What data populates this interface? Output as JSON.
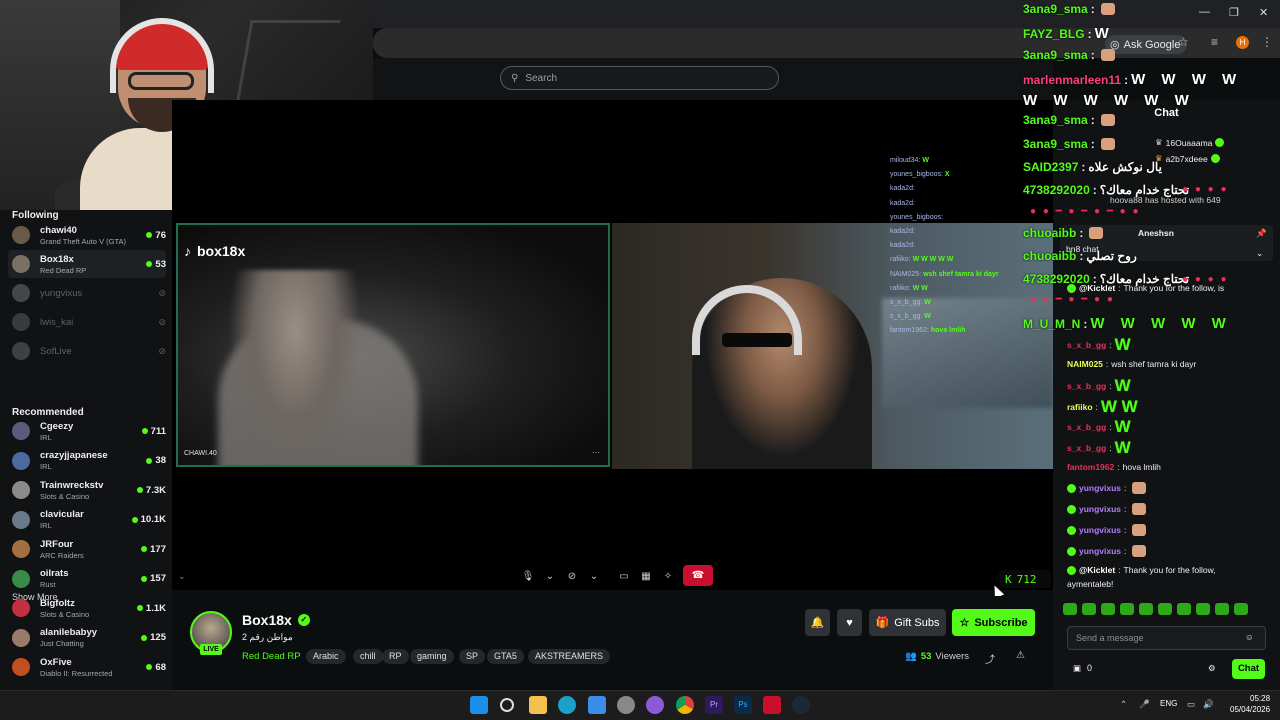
{
  "browser": {
    "ask_google": "Ask Google"
  },
  "search": {
    "placeholder": "Search"
  },
  "sidebar": {
    "following_title": "Following",
    "following": [
      {
        "name": "chawi40",
        "game": "Grand Theft Auto V (GTA)",
        "viewers": "76",
        "online": true,
        "color": "#6b5a4a"
      },
      {
        "name": "Box18x",
        "game": "Red Dead RP",
        "viewers": "53",
        "online": true,
        "active": true,
        "color": "#7a7064"
      },
      {
        "name": "yungvixus",
        "online": false,
        "color": "#aaa"
      },
      {
        "name": "lwis_kai",
        "online": false,
        "color": "#888"
      },
      {
        "name": "SofLive",
        "online": false,
        "color": "#999"
      }
    ],
    "show_more": "Show More",
    "recommended_title": "Recommended",
    "recommended": [
      {
        "name": "Cgeezy",
        "game": "IRL",
        "viewers": "711",
        "color": "#5a5a7a"
      },
      {
        "name": "crazyjjapanese",
        "game": "IRL",
        "viewers": "38",
        "color": "#4a6aa0"
      },
      {
        "name": "Trainwreckstv",
        "game": "Slots & Casino",
        "viewers": "7.3K",
        "color": "#8a8a8a"
      },
      {
        "name": "clavicular",
        "game": "IRL",
        "viewers": "10.1K",
        "color": "#6a7a8a"
      },
      {
        "name": "JRFour",
        "game": "ARC Raiders",
        "viewers": "177",
        "color": "#a07040"
      },
      {
        "name": "oilrats",
        "game": "Rust",
        "viewers": "157",
        "color": "#3a8a4a"
      },
      {
        "name": "Bigfoltz",
        "game": "Slots & Casino",
        "viewers": "1.1K",
        "color": "#c03040"
      },
      {
        "name": "alanilebabyy",
        "game": "Just Chatting",
        "viewers": "125",
        "color": "#9a7a6a"
      },
      {
        "name": "OxFive",
        "game": "Diablo II: Resurrected",
        "viewers": "68",
        "color": "#c05020"
      }
    ]
  },
  "video": {
    "brand": "box18x",
    "tile_name": "CHAWI.40",
    "overlay_count": "712"
  },
  "channel": {
    "name": "Box18x",
    "live_label": "LIVE",
    "title": "2 مواطن رقم",
    "category": "Red Dead RP",
    "tags": [
      "Arabic",
      "chill",
      "RP",
      "gaming",
      "SP",
      "GTA5",
      "AKSTREAMERS"
    ],
    "gift_subs": "Gift Subs",
    "subscribe": "Subscribe",
    "viewers_count": "53",
    "viewers_label": "Viewers"
  },
  "video_chat": [
    {
      "user": "miloud34",
      "text": "W"
    },
    {
      "user": "younes_bigboos",
      "text": "X"
    },
    {
      "user": "kada2d",
      "text": ""
    },
    {
      "user": "kada2d",
      "text": ""
    },
    {
      "user": "younes_bigboos",
      "text": ""
    },
    {
      "user": "kada2d",
      "text": ""
    },
    {
      "user": "kada2d",
      "text": ""
    },
    {
      "user": "rafiiko",
      "text": "W W W W W"
    },
    {
      "user": "NAIM025",
      "text": "wsh shef tamra ki dayr"
    },
    {
      "user": "rafiiko",
      "text": "W W"
    },
    {
      "user": "s_x_b_gg",
      "text": "W"
    },
    {
      "user": "s_x_b_gg",
      "text": "W"
    },
    {
      "user": "fantom1962",
      "text": "hova lmlih"
    }
  ],
  "overlay_chat": [
    {
      "user": "3ana9_sma",
      "color": "#53fc18",
      "msg": ""
    },
    {
      "user": "FAYZ_BLG",
      "color": "#53fc18",
      "msg": "W"
    },
    {
      "user": "3ana9_sma",
      "color": "#53fc18",
      "msg": ""
    },
    {
      "user": "marlenmarleen11",
      "color": "#ff3d7f",
      "msg": "W W W W"
    },
    {
      "user": "",
      "color": "#fff",
      "msg": "W W W W W W"
    },
    {
      "user": "3ana9_sma",
      "color": "#53fc18",
      "msg": ""
    },
    {
      "user": "3ana9_sma",
      "color": "#53fc18",
      "msg": ""
    },
    {
      "user": "SAID2397",
      "color": "#53fc18",
      "msg": "يال نوكش علاه"
    },
    {
      "user": "4738292020",
      "color": "#53fc18",
      "msg": "تحتاج خدام معاك؟"
    },
    {
      "user": "chuoaibb",
      "color": "#53fc18",
      "msg": ""
    },
    {
      "user": "chuoaibb",
      "color": "#53fc18",
      "msg": "روح تصلي"
    },
    {
      "user": "4738292020",
      "color": "#53fc18",
      "msg": "تحتاج خدام معاك؟"
    },
    {
      "user": "M_U_M_N",
      "color": "#53fc18",
      "msg": "W W W W W"
    }
  ],
  "chat": {
    "title": "Chat",
    "top_users": [
      "16Ouaaama",
      "a2b7xdeee"
    ],
    "pinned_user": "Aneshsn",
    "pinned_text": "bn8 chat",
    "messages": [
      {
        "user": "@Kicklet",
        "ucolor": "#fff",
        "text": "Thank you for the follow, is"
      },
      {
        "user": "s_x_b_gg",
        "ucolor": "#e8305a",
        "text": "W"
      },
      {
        "user": "NAIM025",
        "ucolor": "#e8ff5a",
        "text": "wsh shef tamra ki dayr"
      },
      {
        "user": "s_x_b_gg",
        "ucolor": "#e8305a",
        "text": "W"
      },
      {
        "user": "rafiiko",
        "ucolor": "#e8ff5a",
        "text": "W W"
      },
      {
        "user": "s_x_b_gg",
        "ucolor": "#e8305a",
        "text": "W"
      },
      {
        "user": "s_x_b_gg",
        "ucolor": "#e8305a",
        "text": "W"
      },
      {
        "user": "fantom1962",
        "ucolor": "#e8305a",
        "text": "hova lmlih"
      },
      {
        "user": "yungvixus",
        "ucolor": "#b57cff",
        "text": ""
      },
      {
        "user": "yungvixus",
        "ucolor": "#b57cff",
        "text": ""
      },
      {
        "user": "yungvixus",
        "ucolor": "#b57cff",
        "text": ""
      },
      {
        "user": "yungvixus",
        "ucolor": "#b57cff",
        "text": ""
      },
      {
        "user": "@Kicklet",
        "ucolor": "#fff",
        "text": "Thank you for the follow,"
      },
      {
        "user": "",
        "ucolor": "#fff",
        "text": "aymentaleb!"
      }
    ],
    "hosted": "hoova88 has hosted with 649",
    "viewers_note": "649 viewers",
    "input_placeholder": "Send a message",
    "points": "0",
    "send_label": "Chat"
  },
  "taskbar": {
    "lang": "ENG",
    "time": "05:28",
    "date": "05/04/2026"
  },
  "colors": {
    "accent": "#53fc18",
    "danger": "#c8102e"
  }
}
